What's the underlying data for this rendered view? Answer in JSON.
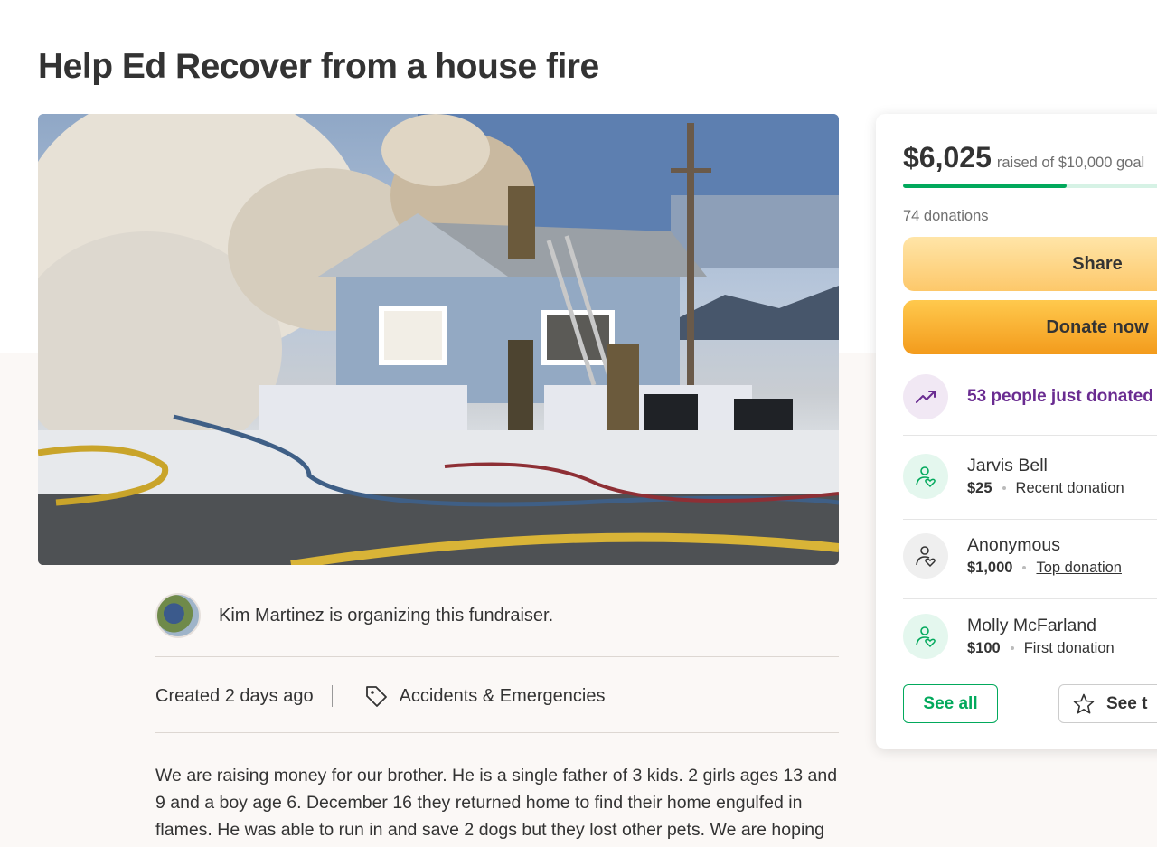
{
  "campaign": {
    "title": "Help Ed Recover from a house fire"
  },
  "organizer": {
    "text": "Kim Martinez is organizing this fundraiser."
  },
  "meta": {
    "created": "Created 2 days ago",
    "category": "Accidents & Emergencies"
  },
  "story": {
    "text": "We are raising money for our brother. He is a single father of 3 kids. 2 girls ages 13 and 9 and a boy age 6. December 16 they returned home to find their home engulfed in flames. He was able to run in and save 2 dogs but they lost other pets. We are hoping"
  },
  "donation": {
    "raised": "$6,025",
    "goal_text": "raised of $10,000 goal",
    "progress": 0.6025,
    "count": "74 donations",
    "share_label": "Share",
    "donate_label": "Donate now",
    "trend_text": "53 people just donated",
    "donors": [
      {
        "name": "Jarvis Bell",
        "amount": "$25",
        "type": "Recent donation"
      },
      {
        "name": "Anonymous",
        "amount": "$1,000",
        "type": "Top donation"
      },
      {
        "name": "Molly McFarland",
        "amount": "$100",
        "type": "First donation"
      }
    ],
    "see_all_label": "See all",
    "see_top_label": "See t"
  },
  "colors": {
    "accent_green": "#02a95c",
    "trend_purple": "#6a2c91",
    "donate_orange": "#f39b1c",
    "share_yellow": "#fdc86a"
  },
  "icons": {
    "category": "tag-icon",
    "trend": "trending-up-icon",
    "donor": "donor-heart-icon",
    "see_top": "star-icon"
  }
}
